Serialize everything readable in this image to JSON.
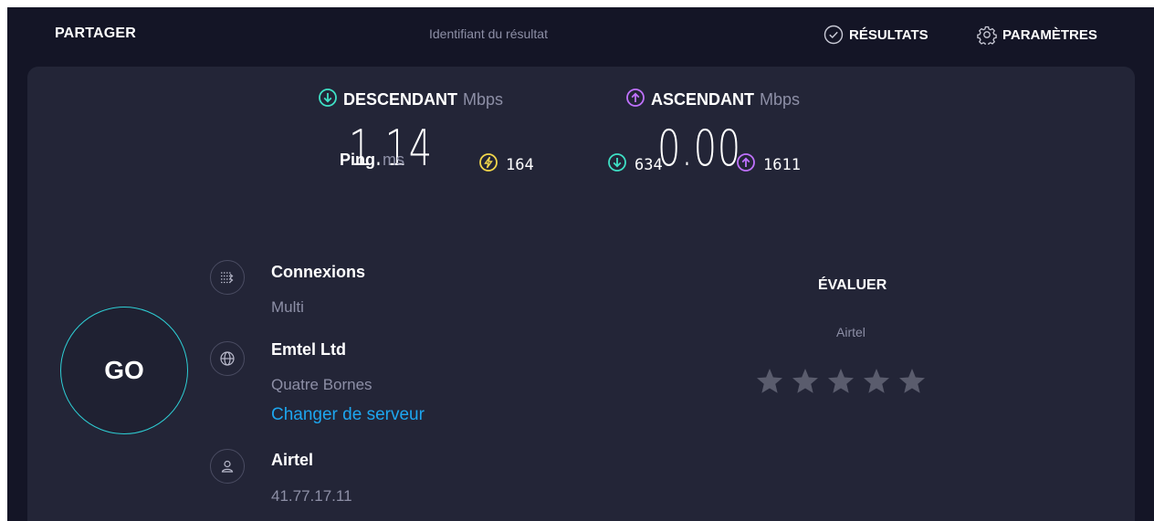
{
  "header": {
    "share_label": "PARTAGER",
    "result_id_label": "Identifiant du résultat",
    "results_label": "RÉSULTATS",
    "settings_label": "PARAMÈTRES"
  },
  "download": {
    "label": "DESCENDANT",
    "unit": "Mbps",
    "value": "1.14",
    "color": "#3ee0c5"
  },
  "upload": {
    "label": "ASCENDANT",
    "unit": "Mbps",
    "value": "0.00",
    "color": "#bf71ff"
  },
  "ping": {
    "label": "Ping",
    "unit": "ms",
    "idle": {
      "value": "164",
      "color": "#f2d64b"
    },
    "download": {
      "value": "634",
      "color": "#3ee0c5"
    },
    "upload": {
      "value": "1611",
      "color": "#bf71ff"
    }
  },
  "go_label": "GO",
  "connections": {
    "title": "Connexions",
    "value": "Multi"
  },
  "server": {
    "title": "Emtel Ltd",
    "location": "Quatre Bornes",
    "change_label": "Changer de serveur"
  },
  "isp": {
    "title": "Airtel",
    "ip": "41.77.17.11"
  },
  "rating": {
    "title": "ÉVALUER",
    "provider": "Airtel",
    "stars_filled": 0,
    "stars_total": 5,
    "star_color": "#5a5c6d"
  }
}
